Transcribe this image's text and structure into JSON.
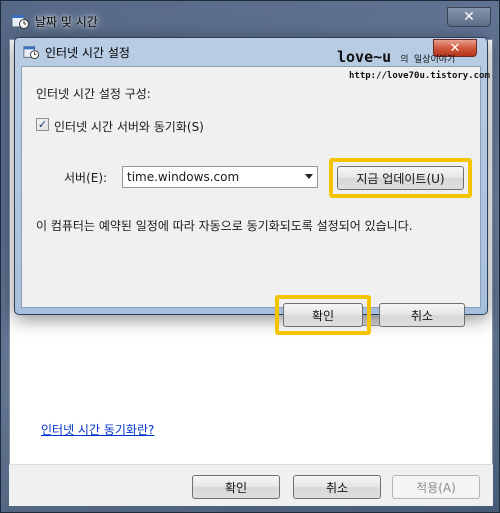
{
  "outer_window": {
    "title": "날짜 및 시간",
    "close_glyph": "✕",
    "link_sync": "인터넷 시간 동기화란?",
    "buttons": {
      "ok": "확인",
      "cancel": "취소",
      "apply": "적용(A)"
    }
  },
  "dialog": {
    "title": "인터넷 시간 설정",
    "close_glyph": "✕",
    "config_label": "인터넷 시간 설정 구성:",
    "sync_checkbox": {
      "label": "인터넷 시간 서버와 동기화(S)",
      "checked": true,
      "mark": "✓"
    },
    "server_label": "서버(E):",
    "server_value": "time.windows.com",
    "update_now_button": "지금 업데이트(U)",
    "status_message": "이 컴퓨터는 예약된 일정에 따라 자동으로 동기화되도록 설정되어 있습니다.",
    "ok_button": "확인",
    "cancel_button": "취소"
  },
  "watermark": {
    "title_main": "love~u",
    "title_suffix": "의 일상이야기",
    "url": "http://love70u.tistory.com"
  },
  "colors": {
    "highlight": "#f3c400",
    "link": "#0033cc",
    "close_button": "#cf5a3e"
  }
}
